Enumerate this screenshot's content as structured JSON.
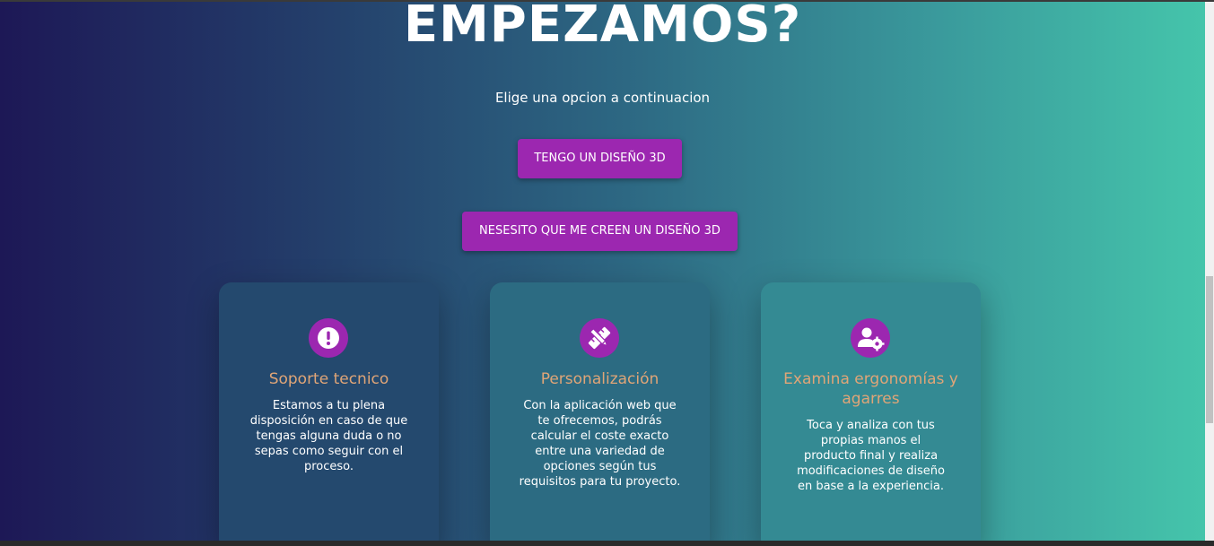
{
  "hero": {
    "title": "EMPEZAMOS?",
    "subtitle": "Elige una opcion a continuacion"
  },
  "buttons": {
    "have_design": "TENGO UN DISEÑO 3D",
    "need_design": "NESESITO QUE ME CREEN UN DISEÑO 3D"
  },
  "cards": [
    {
      "icon": "exclamation-icon",
      "title": "Soporte tecnico",
      "text": "Estamos a tu plena disposición en caso de que tengas alguna duda o no sepas como seguir con el proceso."
    },
    {
      "icon": "pencil-ruler-icon",
      "title": "Personalización",
      "text": "Con la aplicación web que te ofrecemos, podrás calcular el coste exacto entre una variedad de opciones según tus requisitos para tu proyecto."
    },
    {
      "icon": "user-gear-icon",
      "title": "Examina ergonomías y agarres",
      "text": "Toca y analiza con tus propias manos el producto final y realiza modificaciones de diseño en base a la experiencia."
    }
  ],
  "colors": {
    "accent": "#9c27b0",
    "card_title": "#e0a577",
    "gradient_start": "#1d1856",
    "gradient_end": "#45c5ab"
  }
}
